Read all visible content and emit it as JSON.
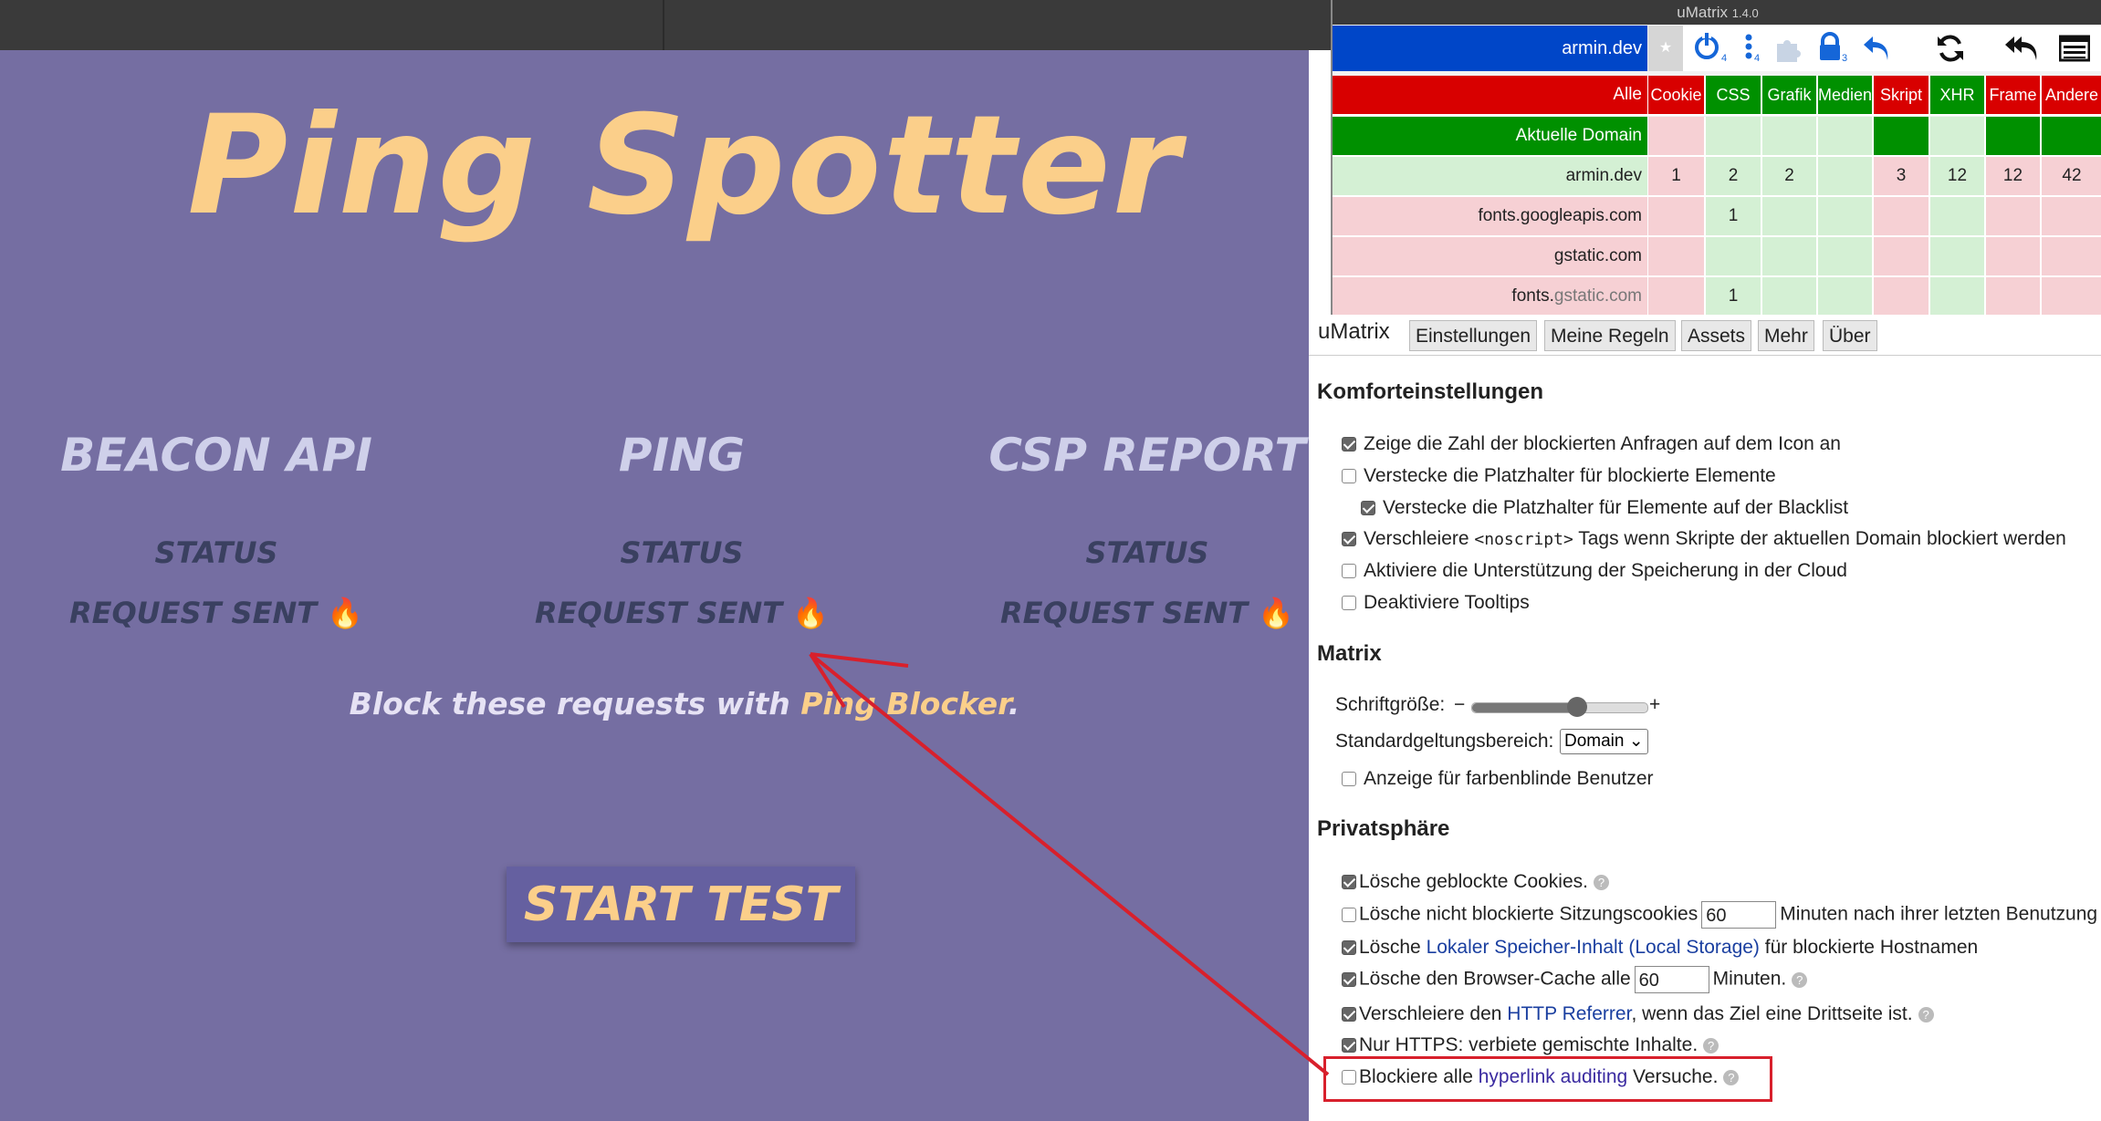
{
  "app": {
    "title": "Ping Spotter",
    "columns": [
      {
        "heading": "BEACON API",
        "status": "STATUS",
        "result": "REQUEST SENT"
      },
      {
        "heading": "PING",
        "status": "STATUS",
        "result": "REQUEST SENT"
      },
      {
        "heading": "CSP REPORT",
        "status": "STATUS",
        "result": "REQUEST SENT"
      }
    ],
    "flame": "🔥",
    "block_note_pre": "Block these requests with ",
    "block_note_link": "Ping Blocker",
    "block_note_post": ".",
    "start_button": "START TEST",
    "colors": {
      "background": "#756ea2",
      "accent": "#fbcf8a"
    }
  },
  "umatrix": {
    "title": "uMatrix",
    "version": "1.4.0",
    "domain": "armin.dev",
    "toolbar_counts": {
      "power": "4",
      "dots": "4",
      "lock": "3"
    },
    "header": {
      "label": "Alle",
      "types": [
        "Cookie",
        "CSS",
        "Grafik",
        "Medien",
        "Skript",
        "XHR",
        "Frame",
        "Andere"
      ]
    },
    "rows": [
      {
        "label": "Aktuelle Domain",
        "cells": [
          "",
          "",
          "",
          "",
          "",
          "",
          "",
          ""
        ]
      },
      {
        "label": "armin.dev",
        "cells": [
          "1",
          "2",
          "2",
          "",
          "3",
          "12",
          "12",
          "42"
        ]
      },
      {
        "label": "fonts.googleapis.com",
        "cells": [
          "",
          "1",
          "",
          "",
          "",
          "",
          "",
          ""
        ]
      },
      {
        "label": "gstatic.com",
        "cells": [
          "",
          "",
          "",
          "",
          "",
          "",
          "",
          ""
        ]
      },
      {
        "label_pre": "fonts.",
        "label_post": "gstatic.com",
        "cells": [
          "",
          "1",
          "",
          "",
          "",
          "",
          "",
          ""
        ]
      }
    ],
    "colors": {
      "allow": "#d4f0d4",
      "block": "#f6d0d4",
      "allow_strong": "#009000",
      "block_strong": "#d80000",
      "domain_bar": "#0046c8"
    }
  },
  "settings": {
    "tabs": [
      "uMatrix",
      "Einstellungen",
      "Meine Regeln",
      "Assets",
      "Mehr",
      "Über"
    ],
    "active_tab": "Einstellungen",
    "comfort": {
      "heading": "Komforteinstellungen",
      "options": [
        {
          "label": "Zeige die Zahl der blockierten Anfragen auf dem Icon an",
          "checked": true
        },
        {
          "label": "Verstecke die Platzhalter für blockierte Elemente",
          "checked": false
        },
        {
          "label": "Verstecke die Platzhalter für Elemente auf der Blacklist",
          "checked": true
        },
        {
          "label_pre": "Verschleiere ",
          "code": "<noscript>",
          "label_post": " Tags wenn Skripte der aktuellen Domain blockiert werden",
          "checked": true
        },
        {
          "label": "Aktiviere die Unterstützung der Speicherung in der Cloud",
          "checked": false
        },
        {
          "label": "Deaktiviere Tooltips",
          "checked": false
        }
      ]
    },
    "matrix": {
      "heading": "Matrix",
      "font_size_label": "Schriftgröße:",
      "minus": "−",
      "plus": "+",
      "font_size_level": 0.6,
      "scope_label": "Standardgeltungsbereich:",
      "scope_value": "Domain",
      "colorblind_label": "Anzeige für farbenblinde Benutzer",
      "colorblind_checked": false
    },
    "privacy": {
      "heading": "Privatsphäre",
      "help": "?",
      "o1": "Lösche geblockte Cookies.",
      "o2_pre": "Lösche nicht blockierte Sitzungscookies",
      "o2_value": "60",
      "o2_post": "Minuten nach ihrer letzten Benutzung",
      "o3_pre": "Lösche ",
      "o3_link": "Lokaler Speicher-Inhalt (Local Storage)",
      "o3_post": " für blockierte Hostnamen",
      "o4_pre": "Lösche den Browser-Cache alle",
      "o4_value": "60",
      "o4_post": "Minuten.",
      "o5_pre": "Verschleiere den ",
      "o5_link": "HTTP Referrer",
      "o5_post": ", wenn das Ziel eine Drittseite ist.",
      "o6": "Nur HTTPS: verbiete gemischte Inhalte.",
      "o7_pre": "Blockiere alle ",
      "o7_link": "hyperlink auditing",
      "o7_post": " Versuche."
    }
  }
}
